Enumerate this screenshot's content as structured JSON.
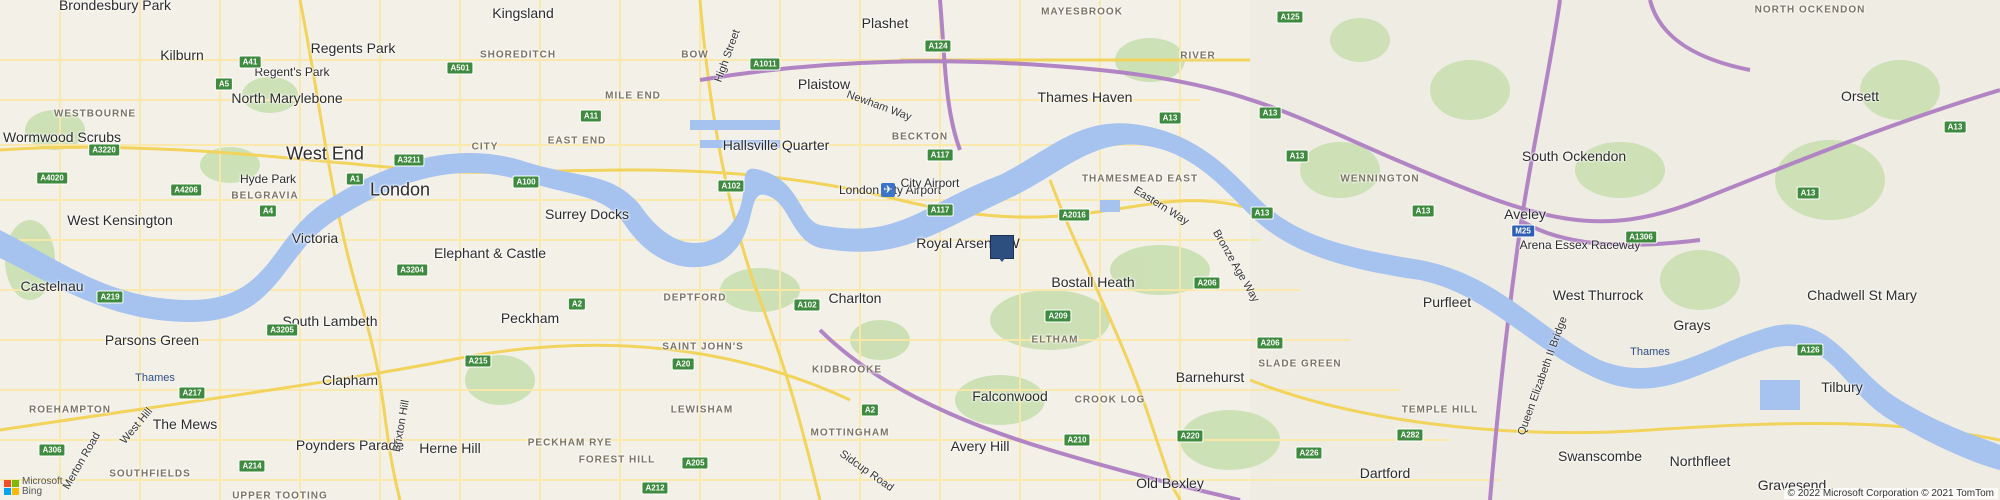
{
  "map": {
    "colors": {
      "land": "#efece3",
      "urban": "#f4f1ea",
      "park": "#c9dfb0",
      "water": "#a6c3f0",
      "motorway": "#b184c4",
      "primary": "#f2d35c",
      "secondary": "#fbe8a6",
      "shield": "#3e8a3e",
      "pin": "#2d4f80"
    },
    "places": [
      {
        "name": "Brondesbury Park",
        "kind": "town"
      },
      {
        "name": "Kingsland",
        "kind": "town"
      },
      {
        "name": "Plashet",
        "kind": "town"
      },
      {
        "name": "MAYESBROOK",
        "kind": "district"
      },
      {
        "name": "NORTH OCKENDON",
        "kind": "district"
      },
      {
        "name": "Kilburn",
        "kind": "town"
      },
      {
        "name": "Regents Park",
        "kind": "town"
      },
      {
        "name": "SHOREDITCH",
        "kind": "district"
      },
      {
        "name": "BOW",
        "kind": "district"
      },
      {
        "name": "RIVER",
        "kind": "district"
      },
      {
        "name": "Regent's Park",
        "kind": "small"
      },
      {
        "name": "North Marylebone",
        "kind": "town"
      },
      {
        "name": "MILE END",
        "kind": "district"
      },
      {
        "name": "Plaistow",
        "kind": "town"
      },
      {
        "name": "Thames Haven",
        "kind": "town"
      },
      {
        "name": "Orsett",
        "kind": "town"
      },
      {
        "name": "WESTBOURNE",
        "kind": "district"
      },
      {
        "name": "EAST END",
        "kind": "district"
      },
      {
        "name": "Wormwood Scrubs",
        "kind": "town"
      },
      {
        "name": "BECKTON",
        "kind": "district"
      },
      {
        "name": "Hallsville Quarter",
        "kind": "town"
      },
      {
        "name": "West End",
        "kind": "major"
      },
      {
        "name": "CITY",
        "kind": "district"
      },
      {
        "name": "South Ockendon",
        "kind": "town"
      },
      {
        "name": "Hyde Park",
        "kind": "small"
      },
      {
        "name": "BELGRAVIA",
        "kind": "district"
      },
      {
        "name": "London",
        "kind": "major"
      },
      {
        "name": "THAMESMEAD EAST",
        "kind": "district"
      },
      {
        "name": "WENNINGTON",
        "kind": "district"
      },
      {
        "name": "London City Airport",
        "kind": "small"
      },
      {
        "name": "City Airport",
        "kind": "small"
      },
      {
        "name": "Surrey Docks",
        "kind": "town"
      },
      {
        "name": "Aveley",
        "kind": "town"
      },
      {
        "name": "West Kensington",
        "kind": "town"
      },
      {
        "name": "Victoria",
        "kind": "town"
      },
      {
        "name": "Elephant & Castle",
        "kind": "town"
      },
      {
        "name": "Royal Arsenal W",
        "kind": "town"
      },
      {
        "name": "Arena Essex Raceway",
        "kind": "small"
      },
      {
        "name": "Bostall Heath",
        "kind": "town"
      },
      {
        "name": "Castelnau",
        "kind": "town"
      },
      {
        "name": "DEPTFORD",
        "kind": "district"
      },
      {
        "name": "Charlton",
        "kind": "town"
      },
      {
        "name": "Purfleet",
        "kind": "town"
      },
      {
        "name": "West Thurrock",
        "kind": "town"
      },
      {
        "name": "Chadwell St Mary",
        "kind": "town"
      },
      {
        "name": "South Lambeth",
        "kind": "town"
      },
      {
        "name": "Peckham",
        "kind": "town"
      },
      {
        "name": "Parsons Green",
        "kind": "town"
      },
      {
        "name": "ELTHAM",
        "kind": "district"
      },
      {
        "name": "Grays",
        "kind": "town"
      },
      {
        "name": "SAINT JOHN'S",
        "kind": "district"
      },
      {
        "name": "SLADE GREEN",
        "kind": "district"
      },
      {
        "name": "Clapham",
        "kind": "town"
      },
      {
        "name": "KIDBROOKE",
        "kind": "district"
      },
      {
        "name": "Barnehurst",
        "kind": "town"
      },
      {
        "name": "Tilbury",
        "kind": "town"
      },
      {
        "name": "LEWISHAM",
        "kind": "district"
      },
      {
        "name": "Falconwood",
        "kind": "town"
      },
      {
        "name": "CROOK LOG",
        "kind": "district"
      },
      {
        "name": "ROEHAMPTON",
        "kind": "district"
      },
      {
        "name": "The Mews",
        "kind": "town"
      },
      {
        "name": "Herne Hill",
        "kind": "town"
      },
      {
        "name": "PECKHAM RYE",
        "kind": "district"
      },
      {
        "name": "TEMPLE HILL",
        "kind": "district"
      },
      {
        "name": "MOTTINGHAM",
        "kind": "district"
      },
      {
        "name": "Poynders Parade",
        "kind": "town"
      },
      {
        "name": "Avery Hill",
        "kind": "town"
      },
      {
        "name": "Swanscombe",
        "kind": "town"
      },
      {
        "name": "Northfleet",
        "kind": "town"
      },
      {
        "name": "FOREST HILL",
        "kind": "district"
      },
      {
        "name": "Dartford",
        "kind": "town"
      },
      {
        "name": "SOUTHFIELDS",
        "kind": "district"
      },
      {
        "name": "Old Bexley",
        "kind": "town"
      },
      {
        "name": "Gravesend",
        "kind": "town"
      },
      {
        "name": "UPPER TOOTING",
        "kind": "district"
      }
    ],
    "road_names": [
      "High Street",
      "Newham Way",
      "Eastern Way",
      "Bronze Age Way",
      "Queen Elizabeth II Bridge",
      "Brixton Hill",
      "West Hill",
      "Merton Road",
      "Sidcup Road"
    ],
    "water_labels": [
      "Thames",
      "Thames"
    ],
    "shields": [
      "A125",
      "A13",
      "A124",
      "A1011",
      "A41",
      "A501",
      "A5",
      "A11",
      "A13",
      "A13",
      "A13",
      "A3220",
      "A117",
      "A3211",
      "A1",
      "A4206",
      "A4020",
      "A100",
      "A102",
      "A2016",
      "A13",
      "A117",
      "M25",
      "A1306",
      "A4",
      "A3204",
      "A219",
      "A2",
      "A102",
      "A209",
      "A206",
      "A3205",
      "A20",
      "A206",
      "A126",
      "A215",
      "A217",
      "A2",
      "A220",
      "A306",
      "A205",
      "A210",
      "A226",
      "A282",
      "A214",
      "A212",
      "A13",
      "A13"
    ],
    "pin_label": "map-pin",
    "attribution": {
      "logo_text_1": "Microsoft",
      "logo_text_2": "Bing",
      "copyright": "© 2022 Microsoft Corporation © 2021 TomTom"
    }
  }
}
